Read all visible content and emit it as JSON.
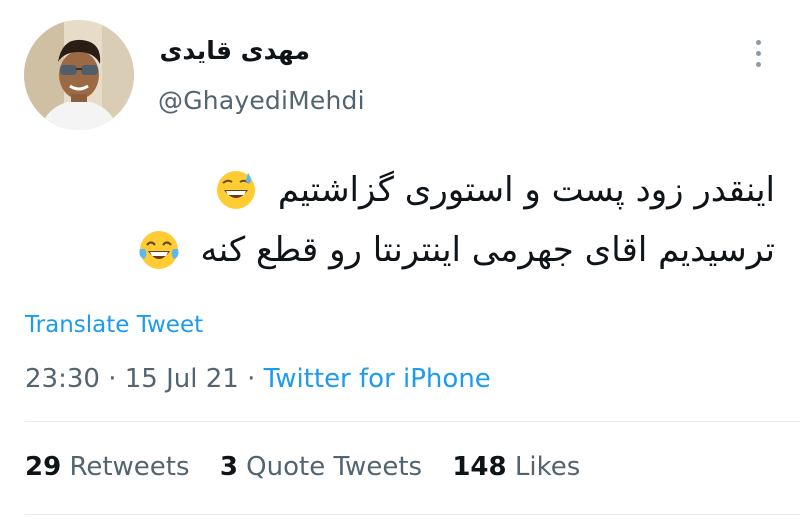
{
  "tweet": {
    "display_name": "مهدی قایدی",
    "handle": "@GhayediMehdi",
    "text_line1": "اینقدر زود پست و استوری گزاشتیم",
    "text_line2": "ترسیدیم اقای جهرمی اینترنتا رو قطع کنه",
    "translate_label": "Translate Tweet",
    "time": "23:30",
    "date": "15 Jul 21",
    "separator": "·",
    "source": "Twitter for iPhone"
  },
  "stats": {
    "retweets_count": "29",
    "retweets_label": "Retweets",
    "quotes_count": "3",
    "quotes_label": "Quote Tweets",
    "likes_count": "148",
    "likes_label": "Likes"
  },
  "icons": {
    "more": "more-vertical-icon",
    "emoji1": "grinning-face-with-sweat-emoji",
    "emoji2": "face-with-tears-of-joy-emoji"
  },
  "colors": {
    "link": "#1d9bf0",
    "secondary_text": "#536471",
    "primary_text": "#0f1419",
    "divider": "#e6ecf0"
  }
}
